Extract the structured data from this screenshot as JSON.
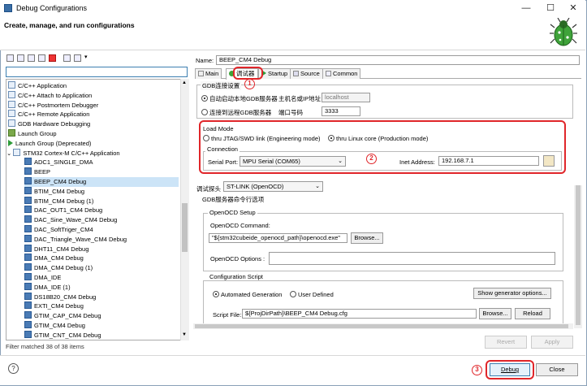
{
  "window": {
    "title": "Debug Configurations",
    "minimize": "—",
    "maximize": "☐",
    "close": "✕"
  },
  "header": {
    "title": "Create, manage, and run configurations"
  },
  "filter": {
    "value": "",
    "status": "Filter matched 38 of 38 items"
  },
  "tree": [
    {
      "label": "C/C++ Application",
      "indent": 0,
      "kind": "cat"
    },
    {
      "label": "C/C++ Attach to Application",
      "indent": 0,
      "kind": "cat"
    },
    {
      "label": "C/C++ Postmortem Debugger",
      "indent": 0,
      "kind": "cat"
    },
    {
      "label": "C/C++ Remote Application",
      "indent": 0,
      "kind": "cat"
    },
    {
      "label": "GDB Hardware Debugging",
      "indent": 0,
      "kind": "cat"
    },
    {
      "label": "Launch Group",
      "indent": 0,
      "kind": "launch"
    },
    {
      "label": "Launch Group (Deprecated)",
      "indent": 0,
      "kind": "launch2"
    },
    {
      "label": "STM32 Cortex-M C/C++ Application",
      "indent": 0,
      "kind": "cat",
      "expanded": true
    },
    {
      "label": "ADC1_SINGLE_DMA",
      "indent": 1,
      "kind": "cfg"
    },
    {
      "label": "BEEP",
      "indent": 1,
      "kind": "cfg"
    },
    {
      "label": "BEEP_CM4 Debug",
      "indent": 1,
      "kind": "cfg",
      "selected": true
    },
    {
      "label": "BTIM_CM4 Debug",
      "indent": 1,
      "kind": "cfg"
    },
    {
      "label": "BTIM_CM4 Debug (1)",
      "indent": 1,
      "kind": "cfg"
    },
    {
      "label": "DAC_OUT1_CM4 Debug",
      "indent": 1,
      "kind": "cfg"
    },
    {
      "label": "DAC_Sine_Wave_CM4 Debug",
      "indent": 1,
      "kind": "cfg"
    },
    {
      "label": "DAC_SoftTriger_CM4",
      "indent": 1,
      "kind": "cfg"
    },
    {
      "label": "DAC_Triangle_Wave_CM4 Debug",
      "indent": 1,
      "kind": "cfg"
    },
    {
      "label": "DHT11_CM4 Debug",
      "indent": 1,
      "kind": "cfg"
    },
    {
      "label": "DMA_CM4 Debug",
      "indent": 1,
      "kind": "cfg"
    },
    {
      "label": "DMA_CM4 Debug (1)",
      "indent": 1,
      "kind": "cfg"
    },
    {
      "label": "DMA_IDE",
      "indent": 1,
      "kind": "cfg"
    },
    {
      "label": "DMA_IDE (1)",
      "indent": 1,
      "kind": "cfg"
    },
    {
      "label": "DS18B20_CM4 Debug",
      "indent": 1,
      "kind": "cfg"
    },
    {
      "label": "EXTI_CM4 Debug",
      "indent": 1,
      "kind": "cfg"
    },
    {
      "label": "GTIM_CAP_CM4 Debug",
      "indent": 1,
      "kind": "cfg"
    },
    {
      "label": "GTIM_CM4 Debug",
      "indent": 1,
      "kind": "cfg"
    },
    {
      "label": "GTIM_CNT_CM4 Debug",
      "indent": 1,
      "kind": "cfg"
    }
  ],
  "config": {
    "name_label": "Name:",
    "name_value": "BEEP_CM4 Debug"
  },
  "tabs": [
    "Main",
    "调试器",
    "Startup",
    "Source",
    "Common"
  ],
  "gdb": {
    "group_title": "GDB连接设置",
    "local_radio": "自动启动本地GDB服务器",
    "host_label": "主机名或IP地址",
    "host_value": "localhost",
    "remote_radio": "连接到远程GDB服务器",
    "port_label": "端口号码",
    "port_value": "3333"
  },
  "load_mode": {
    "title": "Load Mode",
    "jtag_radio": "thru JTAG/SWD link (Engineering mode)",
    "linux_radio": "thru Linux core (Production mode)",
    "connection_title": "Connection",
    "serial_label": "Serial Port:",
    "serial_value": "MPU Serial (COM65)",
    "inet_label": "Inet Address:",
    "inet_value": "192.168.7.1"
  },
  "probe": {
    "label": "调试探头",
    "value": "ST-LINK (OpenOCD)"
  },
  "server_opts": {
    "group_title": "GDB服务器命令行选项",
    "openocd_setup": "OpenOCD Setup",
    "cmd_label": "OpenOCD Command:",
    "cmd_value": "\"${stm32cubeide_openocd_path}\\openocd.exe\"",
    "browse": "Browse...",
    "options_label": "OpenOCD Options :",
    "options_value": ""
  },
  "script": {
    "group_title": "Configuration Script",
    "auto_radio": "Automated Generation",
    "user_radio": "User Defined",
    "show_btn": "Show generator options...",
    "file_label": "Script File:",
    "file_value": "${ProjDirPath}\\BEEP_CM4 Debug.cfg",
    "browse": "Browse...",
    "reload": "Reload"
  },
  "actions": {
    "revert": "Revert",
    "apply": "Apply",
    "debug": "Debug",
    "close": "Close",
    "help": "?"
  },
  "annotations": [
    "1",
    "2",
    "3"
  ],
  "colors": {
    "annotation": "#e0262a",
    "selection": "#cce4f7",
    "focus": "#3c7fb1"
  }
}
